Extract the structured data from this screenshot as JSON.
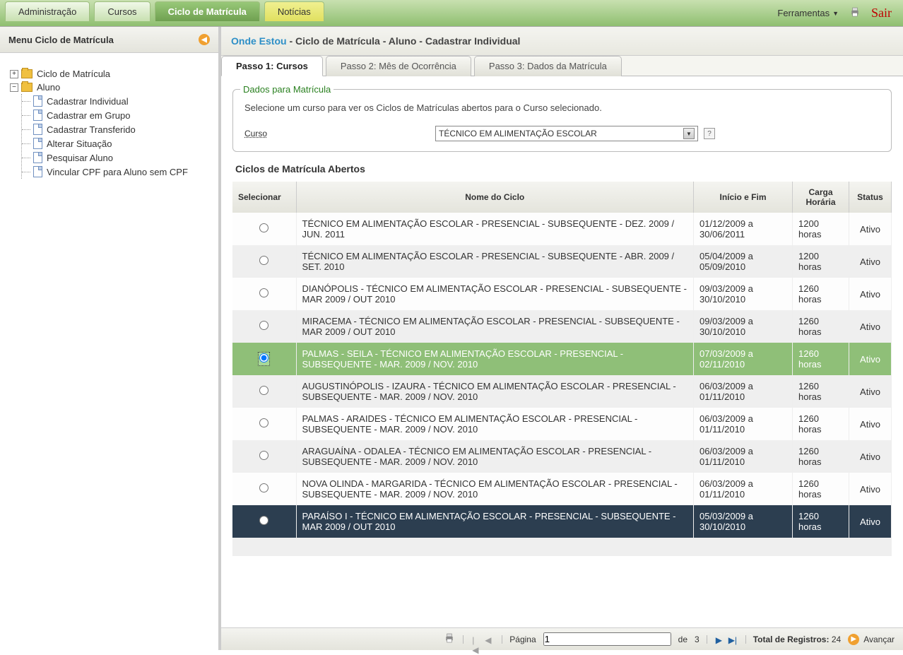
{
  "top_nav": {
    "tabs": [
      "Administração",
      "Cursos",
      "Ciclo de Matrícula",
      "Notícias"
    ],
    "selected_index": 2,
    "yellow_index": 3,
    "ferramentas": "Ferramentas",
    "sair": "Sair"
  },
  "sidebar": {
    "title": "Menu Ciclo de Matrícula",
    "root_collapsed": {
      "label": "Ciclo de Matrícula"
    },
    "root_expanded": {
      "label": "Aluno",
      "children": [
        "Cadastrar Individual",
        "Cadastrar em Grupo",
        "Cadastrar Transferido",
        "Alterar Situação",
        "Pesquisar Aluno",
        "Vincular CPF para Aluno sem CPF"
      ]
    }
  },
  "breadcrumb": {
    "onde": "Onde Estou",
    "rest": " - Ciclo de Matrícula - Aluno - Cadastrar Individual"
  },
  "steps": {
    "tabs": [
      "Passo 1: Cursos",
      "Passo 2: Mês de Ocorrência",
      "Passo 3: Dados da Matrícula"
    ],
    "active_index": 0
  },
  "form": {
    "legend": "Dados para Matrícula",
    "instruction": "Selecione um curso para ver os Ciclos de Matrículas abertos para o Curso selecionado.",
    "curso_label": "Curso",
    "curso_value": "TÉCNICO EM ALIMENTAÇÃO ESCOLAR"
  },
  "grid": {
    "title": "Ciclos de Matrícula Abertos",
    "headers": [
      "Selecionar",
      "Nome do Ciclo",
      "Início e Fim",
      "Carga Horária",
      "Status"
    ],
    "selected_index": 4,
    "hover_index": 9,
    "rows": [
      {
        "nome": "TÉCNICO EM ALIMENTAÇÃO ESCOLAR - PRESENCIAL - SUBSEQUENTE - DEZ. 2009 / JUN. 2011",
        "periodo": "01/12/2009 a 30/06/2011",
        "carga": "1200 horas",
        "status": "Ativo"
      },
      {
        "nome": "TÉCNICO EM ALIMENTAÇÃO ESCOLAR - PRESENCIAL - SUBSEQUENTE - ABR. 2009 / SET. 2010",
        "periodo": "05/04/2009 a 05/09/2010",
        "carga": "1200 horas",
        "status": "Ativo"
      },
      {
        "nome": "DIANÓPOLIS - TÉCNICO EM ALIMENTAÇÃO ESCOLAR - PRESENCIAL - SUBSEQUENTE - MAR 2009 / OUT 2010",
        "periodo": "09/03/2009 a 30/10/2010",
        "carga": "1260 horas",
        "status": "Ativo"
      },
      {
        "nome": "MIRACEMA - TÉCNICO EM ALIMENTAÇÃO ESCOLAR - PRESENCIAL - SUBSEQUENTE - MAR 2009 / OUT 2010",
        "periodo": "09/03/2009 a 30/10/2010",
        "carga": "1260 horas",
        "status": "Ativo"
      },
      {
        "nome": "PALMAS - SEILA - TÉCNICO EM ALIMENTAÇÃO ESCOLAR - PRESENCIAL - SUBSEQUENTE - MAR. 2009 / NOV. 2010",
        "periodo": "07/03/2009 a 02/11/2010",
        "carga": "1260 horas",
        "status": "Ativo"
      },
      {
        "nome": "AUGUSTINÓPOLIS - IZAURA - TÉCNICO EM ALIMENTAÇÃO ESCOLAR - PRESENCIAL - SUBSEQUENTE - MAR. 2009 / NOV. 2010",
        "periodo": "06/03/2009 a 01/11/2010",
        "carga": "1260 horas",
        "status": "Ativo"
      },
      {
        "nome": "PALMAS - ARAIDES - TÉCNICO EM ALIMENTAÇÃO ESCOLAR - PRESENCIAL - SUBSEQUENTE - MAR. 2009 / NOV. 2010",
        "periodo": "06/03/2009 a 01/11/2010",
        "carga": "1260 horas",
        "status": "Ativo"
      },
      {
        "nome": "ARAGUAÍNA - ODALEA - TÉCNICO EM ALIMENTAÇÃO ESCOLAR - PRESENCIAL - SUBSEQUENTE - MAR. 2009 / NOV. 2010",
        "periodo": "06/03/2009 a 01/11/2010",
        "carga": "1260 horas",
        "status": "Ativo"
      },
      {
        "nome": "NOVA OLINDA - MARGARIDA - TÉCNICO EM ALIMENTAÇÃO ESCOLAR - PRESENCIAL - SUBSEQUENTE - MAR. 2009 / NOV. 2010",
        "periodo": "06/03/2009 a 01/11/2010",
        "carga": "1260 horas",
        "status": "Ativo"
      },
      {
        "nome": "PARAÍSO I - TÉCNICO EM ALIMENTAÇÃO ESCOLAR - PRESENCIAL - SUBSEQUENTE - MAR 2009 / OUT 2010",
        "periodo": "05/03/2009 a 30/10/2010",
        "carga": "1260 horas",
        "status": "Ativo"
      }
    ]
  },
  "pager": {
    "pagina_label": "Página",
    "page": "1",
    "de_label": "de",
    "total_pages": "3",
    "total_label": "Total de Registros:",
    "total_value": "24"
  },
  "footer": {
    "avancar": "Avançar"
  }
}
